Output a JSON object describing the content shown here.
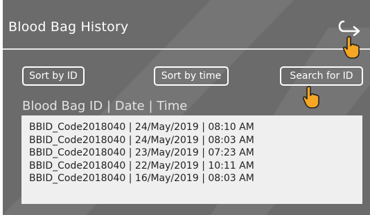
{
  "header": {
    "title": "Blood Bag History",
    "back_icon": "return-arrow-icon"
  },
  "toolbar": {
    "sort_by_id_label": "Sort by ID",
    "sort_by_time_label": "Sort by time",
    "search_label": "Search for ID"
  },
  "list": {
    "column_header": "Blood Bag ID | Date | Time",
    "rows": [
      "BBID_Code2018040 | 24/May/2019 | 08:10 AM",
      "BBID_Code2018040 | 24/May/2019 | 08:03 AM",
      "BBID_Code2018040 | 23/May/2019 | 07:23 AM",
      "BBID_Code2018040 | 22/May/2019 | 10:11 AM",
      "BBID_Code2018040 | 16/May/2019 | 08:03 AM"
    ]
  },
  "colors": {
    "panel_background": "#6b6b6b",
    "list_background": "#efefef",
    "accent_hand": "#f5a623"
  }
}
